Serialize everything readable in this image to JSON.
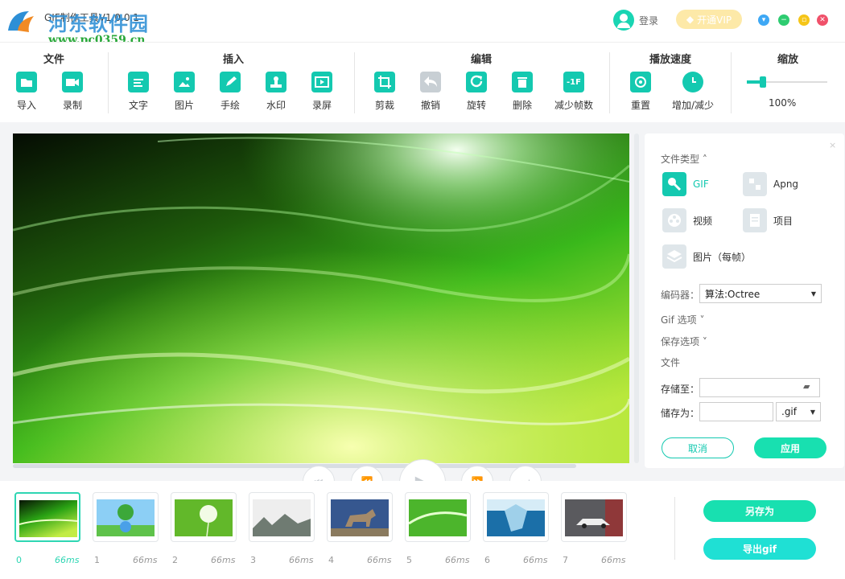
{
  "window": {
    "title": "GIF制作工具V1.0.0.1",
    "watermark": "河东软件园",
    "watermark_url": "www.pc0359.cn",
    "login_label": "登录",
    "vip_label": "开通VIP"
  },
  "toolbar": {
    "groups": [
      {
        "title": "文件",
        "items": [
          "导入",
          "录制"
        ]
      },
      {
        "title": "插入",
        "items": [
          "文字",
          "图片",
          "手绘",
          "水印",
          "录屏"
        ]
      },
      {
        "title": "编辑",
        "items": [
          "剪裁",
          "撤销",
          "旋转",
          "删除",
          "减少帧数"
        ]
      },
      {
        "title": "播放速度",
        "items": [
          "重置",
          "增加/减少"
        ]
      },
      {
        "title": "缩放",
        "items": []
      }
    ],
    "zoom_value": "100%",
    "reduce_frames_icon_text": "-1F"
  },
  "panel": {
    "file_type_label": "文件类型",
    "file_types": [
      "GIF",
      "Apng",
      "视频",
      "项目",
      "图片（每帧）"
    ],
    "selected_type": "GIF",
    "encoder_label": "编码器：",
    "encoder_value": "算法:Octree",
    "gif_options_label": "Gif 选项",
    "save_options_label": "保存选项",
    "file_section_label": "文件",
    "save_to_label": "存储至：",
    "save_as_label": "储存为：",
    "save_to_value": "",
    "save_as_value": "",
    "extension_value": ".gif",
    "cancel_label": "取消",
    "apply_label": "应用"
  },
  "frames": [
    {
      "index": "0",
      "duration": "66ms",
      "scene": "green-aurora",
      "selected": true
    },
    {
      "index": "1",
      "duration": "66ms",
      "scene": "tree-globe",
      "selected": false
    },
    {
      "index": "2",
      "duration": "66ms",
      "scene": "dandelion",
      "selected": false
    },
    {
      "index": "3",
      "duration": "66ms",
      "scene": "ink-landscape",
      "selected": false
    },
    {
      "index": "4",
      "duration": "66ms",
      "scene": "wolf",
      "selected": false
    },
    {
      "index": "5",
      "duration": "66ms",
      "scene": "green-light",
      "selected": false
    },
    {
      "index": "6",
      "duration": "66ms",
      "scene": "iceberg",
      "selected": false
    },
    {
      "index": "7",
      "duration": "66ms",
      "scene": "car",
      "selected": false
    }
  ],
  "actions": {
    "save_as_label": "另存为",
    "export_gif_label": "导出gif"
  },
  "colors": {
    "accent": "#14c9b0",
    "button_green": "#18e0b0",
    "vip_bg": "#fde9a8",
    "close_red": "#f0516a",
    "minimize_green": "#2ecc71",
    "maximize_yellow": "#f5c518",
    "restore_blue": "#3ea8f5"
  }
}
